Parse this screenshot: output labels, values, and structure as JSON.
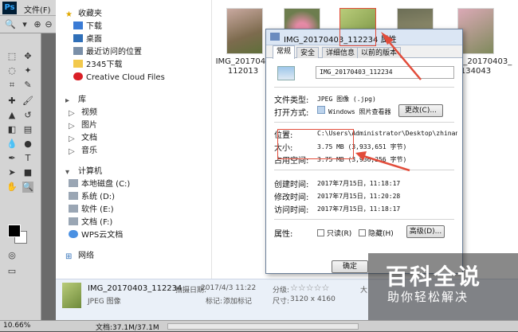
{
  "photoshop": {
    "logo": "Ps",
    "menu_file": "文件(F)",
    "zoom": "10.66%",
    "doc_info": "文档:37.1M/37.1M"
  },
  "nav": {
    "favorites": "收藏夹",
    "downloads": "下载",
    "desktop": "桌面",
    "recent": "最近访问的位置",
    "downloads2345": "2345下载",
    "creative_cloud": "Creative Cloud Files",
    "libraries": "库",
    "videos": "视频",
    "pictures": "图片",
    "documents": "文档",
    "music": "音乐",
    "computer": "计算机",
    "local_disk_c": "本地磁盘 (C:)",
    "system_d": "系统 (D:)",
    "software_e": "软件 (E:)",
    "docs_f": "文档 (F:)",
    "wps_cloud": "WPS云文档",
    "network": "网络"
  },
  "thumbs": {
    "t1_label_line1": "IMG_2017040",
    "t1_label_line2": "112013",
    "t5_label_line1": "IMG_20170403_",
    "t5_label_line2": "134043"
  },
  "details": {
    "filename": "IMG_20170403_112234",
    "date_label": "拍摄日期:",
    "date_value": "2017/4/3 11:22",
    "rating_label": "分级:",
    "rating_stars": "☆☆☆☆☆",
    "type": "JPEG 图像",
    "tags_label": "标记:",
    "tags_value": "添加标记",
    "dims_label": "尺寸:",
    "dims_value": "3120 x 4160",
    "size_label": "大"
  },
  "dialog": {
    "title": "IMG_20170403_112234 属性",
    "tabs": [
      "常规",
      "安全",
      "详细信息",
      "以前的版本"
    ],
    "filename": "IMG_20170403_112234",
    "type_label": "文件类型:",
    "type_value": "JPEG 图像 (.jpg)",
    "open_label": "打开方式:",
    "open_value": "Windows 照片查看器",
    "change_button": "更改(C)...",
    "location_label": "位置:",
    "location_value": "C:\\Users\\Administrator\\Desktop\\zhinan\\pic",
    "size_label": "大小:",
    "size_value": "3.75 MB (3,933,651 字节)",
    "disk_label": "占用空间:",
    "disk_value": "3.75 MB (3,936,256 字节)",
    "created_label": "创建时间:",
    "created_value": "2017年7月15日，11:18:17",
    "modified_label": "修改时间:",
    "modified_value": "2017年7月15日，11:20:28",
    "accessed_label": "访问时间:",
    "accessed_value": "2017年7月15日，11:18:17",
    "attr_label": "属性:",
    "readonly": "只读(R)",
    "hidden": "隐藏(H)",
    "advanced_button": "高级(D)...",
    "ok_button": "确定"
  },
  "watermark": {
    "title": "百科全说",
    "subtitle": "助你轻松解决"
  }
}
